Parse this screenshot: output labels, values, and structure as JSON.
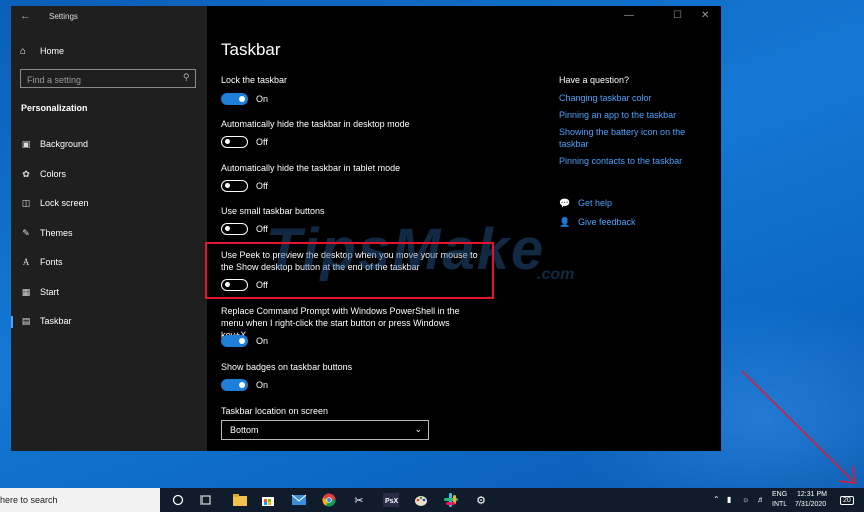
{
  "window": {
    "app_title": "Settings",
    "home_label": "Home",
    "search_placeholder": "Find a setting",
    "section": "Personalization",
    "nav": [
      {
        "label": "Background",
        "icon": "picture-icon"
      },
      {
        "label": "Colors",
        "icon": "palette-icon"
      },
      {
        "label": "Lock screen",
        "icon": "monitor-lock-icon"
      },
      {
        "label": "Themes",
        "icon": "brush-icon"
      },
      {
        "label": "Fonts",
        "icon": "font-icon"
      },
      {
        "label": "Start",
        "icon": "start-grid-icon"
      },
      {
        "label": "Taskbar",
        "icon": "taskbar-icon"
      }
    ],
    "active_nav": "Taskbar"
  },
  "page": {
    "title": "Taskbar",
    "settings": [
      {
        "label": "Lock the taskbar",
        "state": "On"
      },
      {
        "label": "Automatically hide the taskbar in desktop mode",
        "state": "Off"
      },
      {
        "label": "Automatically hide the taskbar in tablet mode",
        "state": "Off"
      },
      {
        "label": "Use small taskbar buttons",
        "state": "Off"
      },
      {
        "label": "Use Peek to preview the desktop when you move your mouse to the Show desktop button at the end of the taskbar",
        "state": "Off"
      },
      {
        "label": "Replace Command Prompt with Windows PowerShell in the menu when I right-click the start button or press Windows key+X",
        "state": "On"
      },
      {
        "label": "Show badges on taskbar buttons",
        "state": "On"
      }
    ],
    "location_label": "Taskbar location on screen",
    "location_value": "Bottom"
  },
  "help": {
    "title": "Have a question?",
    "links": [
      "Changing taskbar color",
      "Pinning an app to the taskbar",
      "Showing the battery icon on the taskbar",
      "Pinning contacts to the taskbar"
    ],
    "get_help": "Get help",
    "give_feedback": "Give feedback"
  },
  "watermark": {
    "main": "TipsMake",
    "suffix": ".com"
  },
  "taskbar": {
    "search_text": "here to search",
    "lang": "ENG",
    "layout": "INTL",
    "time": "12:31 PM",
    "date": "7/31/2020",
    "notification_count": "20"
  },
  "colors": {
    "accent": "#1f7fd8",
    "link": "#4aa3ff",
    "highlight": "#e2172f"
  }
}
